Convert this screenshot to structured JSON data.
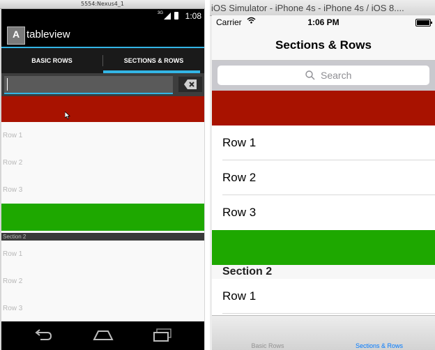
{
  "android": {
    "window_title": "5554:Nexus4_1",
    "status": {
      "network": "3G",
      "time": "1:08"
    },
    "app_icon_letter": "A",
    "app_title": "tableview",
    "tabs": [
      {
        "label": "BASIC ROWS"
      },
      {
        "label": "SECTIONS & ROWS",
        "selected": true
      }
    ],
    "search": {
      "value": "",
      "placeholder": ""
    },
    "rows_section1": [
      "Row 1",
      "Row 2",
      "Row 3"
    ],
    "section2_header": "Section 2",
    "rows_section2": [
      "Row 1",
      "Row 2",
      "Row 3"
    ],
    "nav_icons": [
      "back-icon",
      "home-icon",
      "recent-apps-icon"
    ]
  },
  "ios": {
    "window_title": "iOS Simulator - iPhone 4s - iPhone 4s / iOS 8....",
    "status": {
      "carrier": "Carrier",
      "time": "1:06 PM"
    },
    "nav_title": "Sections & Rows",
    "search": {
      "placeholder": "Search"
    },
    "rows_section1": [
      "Row 1",
      "Row 2",
      "Row 3"
    ],
    "section2_header": "Section 2",
    "rows_section2": [
      "Row 1"
    ],
    "tabs": [
      {
        "label": "Basic Rows"
      },
      {
        "label": "Sections & Rows",
        "selected": true
      }
    ]
  },
  "colors": {
    "red_header": "#a81200",
    "green_footer": "#1ea800",
    "android_accent": "#33b5e5",
    "ios_tint": "#007aff"
  }
}
